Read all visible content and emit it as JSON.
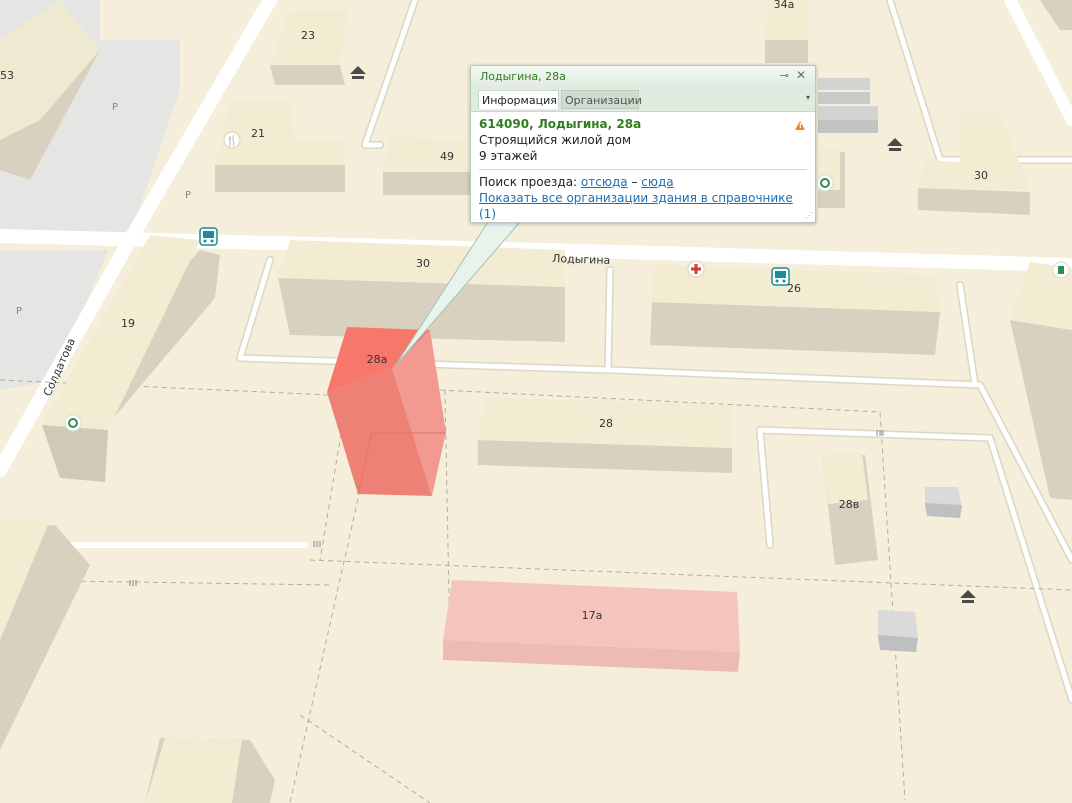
{
  "popup": {
    "title": "Лодыгина, 28а",
    "pin_glyph": "⊸",
    "close_glyph": "✕",
    "tabs": [
      {
        "label": "Информация",
        "active": true
      },
      {
        "label": "Организации",
        "active": false
      }
    ],
    "tab_menu_glyph": "▾",
    "address": "614090, Лодыгина, 28а",
    "description": "Строящийся жилой дом",
    "floors": "9 этажей",
    "route_label": "Поиск проезда:",
    "route_from": "отсюда",
    "route_dash": "–",
    "route_to": "сюда",
    "show_orgs_link": "Показать все организации здания в справочнике",
    "show_orgs_count": "(1)",
    "warning_icon": "warning-triangle-icon",
    "warning_color": "#e8891c"
  },
  "map": {
    "colors": {
      "background": "#f4eedb",
      "road": "#ffffff",
      "building_top": "#f3ecd2",
      "building_side": "#d8d1bf",
      "selected_building": "#f38a7e",
      "highlighted_building": "#f5c4bd",
      "parking_area": "#e4e4e4",
      "icon_green": "#2f8b57",
      "icon_bus": "#1c8c9a"
    },
    "streets": [
      {
        "name": "Лодыгина"
      },
      {
        "name": "Солдатова"
      }
    ],
    "buildings": [
      {
        "label": "53"
      },
      {
        "label": "23"
      },
      {
        "label": "21"
      },
      {
        "label": "49"
      },
      {
        "label": "34а"
      },
      {
        "label": "30"
      },
      {
        "label": "30"
      },
      {
        "label": "19"
      },
      {
        "label": "26"
      },
      {
        "label": "28а"
      },
      {
        "label": "28"
      },
      {
        "label": "28в"
      },
      {
        "label": "17а"
      }
    ],
    "parking_labels": [
      "P",
      "P",
      "P"
    ],
    "pois": [
      {
        "icon": "bus-stop-icon"
      },
      {
        "icon": "bus-stop-icon"
      },
      {
        "icon": "playground-icon"
      },
      {
        "icon": "playground-icon"
      },
      {
        "icon": "playground-icon"
      },
      {
        "icon": "restaurant-icon"
      },
      {
        "icon": "pharmacy-icon"
      },
      {
        "icon": "recycling-icon"
      },
      {
        "icon": "recycling-icon"
      },
      {
        "icon": "shop-icon"
      }
    ]
  }
}
